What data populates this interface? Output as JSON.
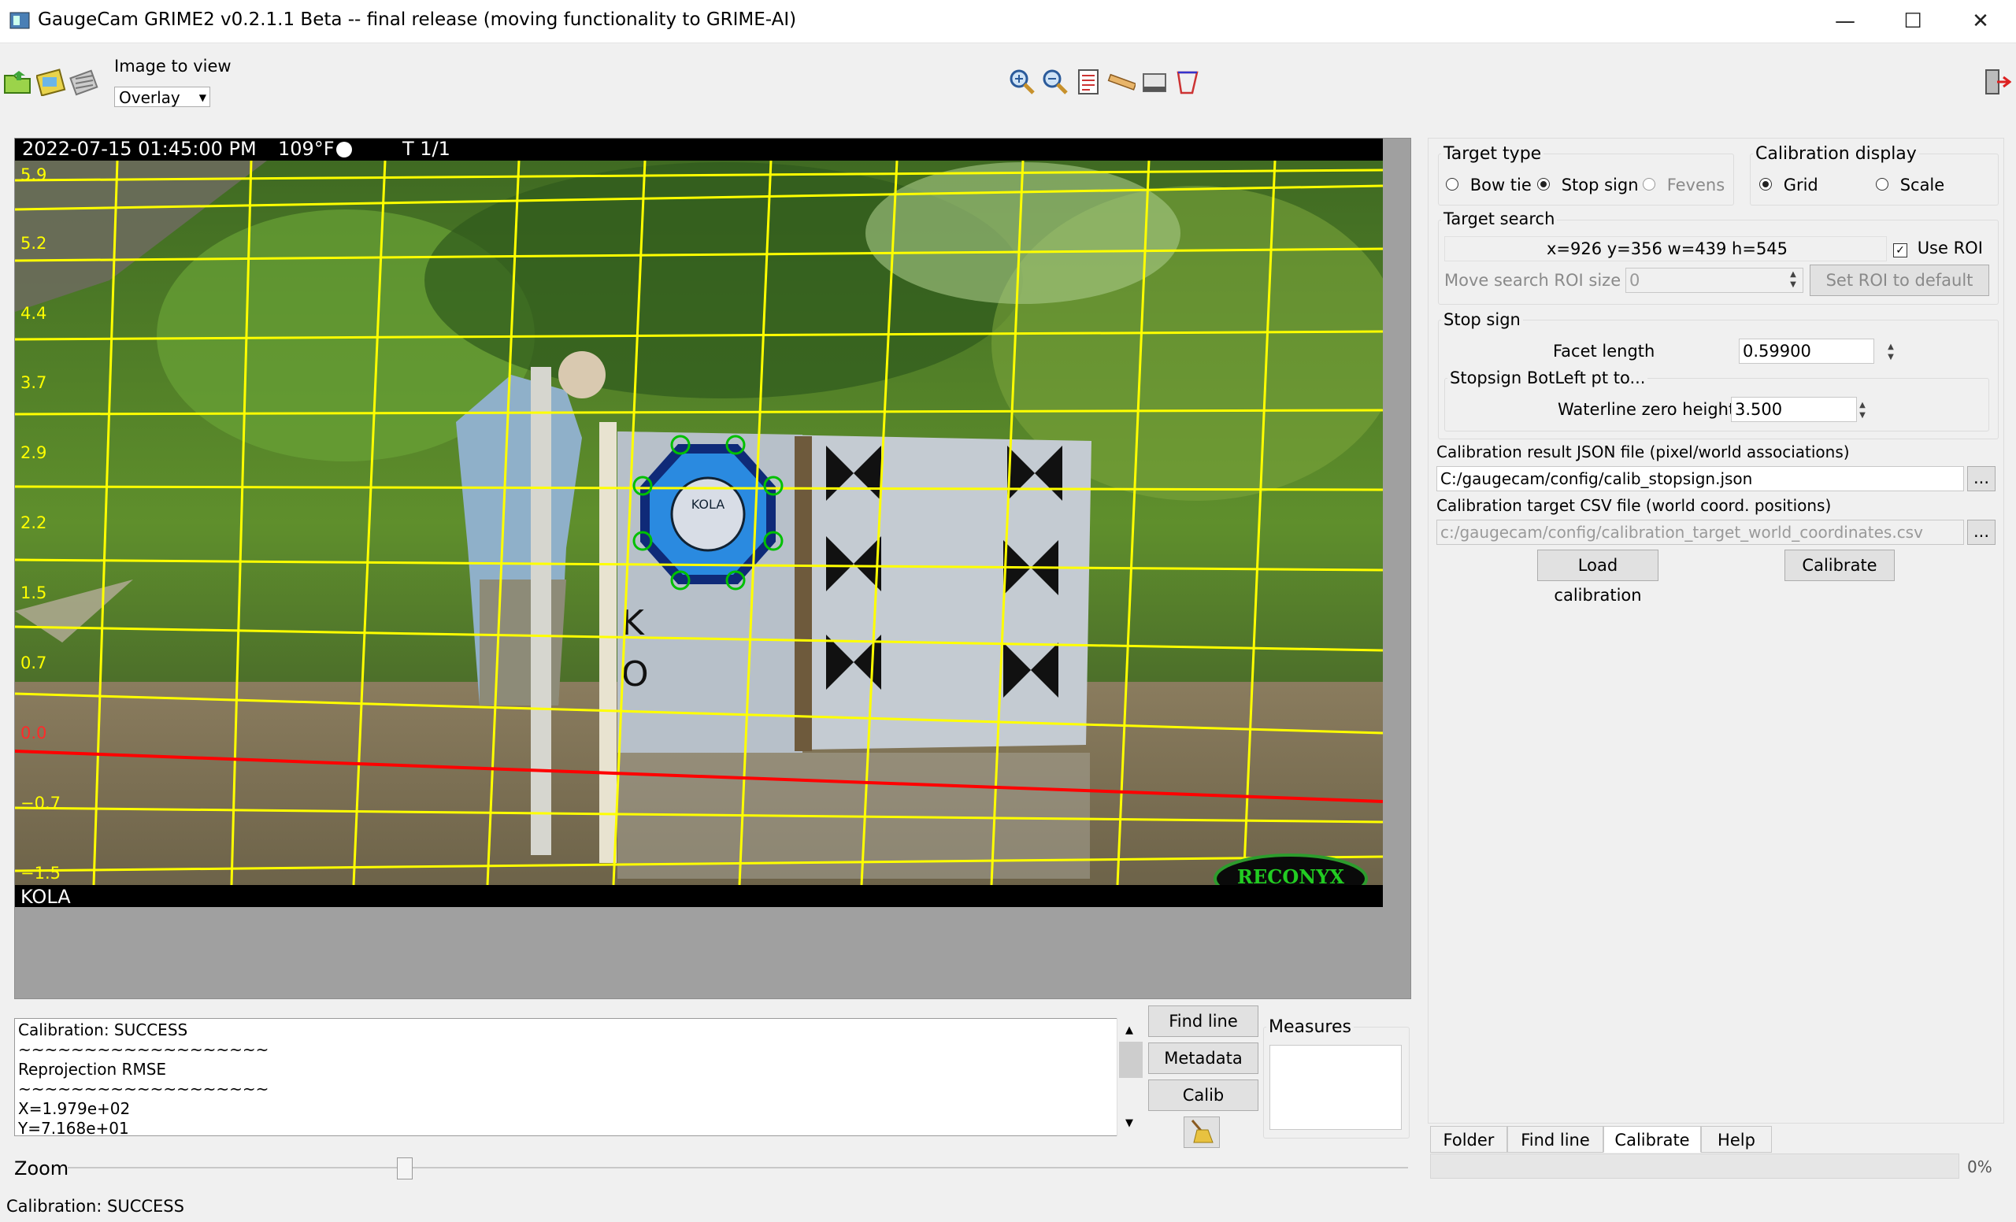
{
  "window": {
    "title": "GaugeCam GRIME2 v0.2.1.1 Beta -- final release (moving functionality to GRIME-AI)",
    "minimize": "—",
    "maximize": "☐",
    "close": "✕"
  },
  "toolbar": {
    "image_to_view_label": "Image to view",
    "image_to_view_value": "Overlay",
    "tools": [
      "zoom-in-icon",
      "zoom-out-icon",
      "list-icon",
      "ruler-icon",
      "rectangle-icon",
      "polygon-icon"
    ]
  },
  "image": {
    "timestamp": "2022-07-15 01:45:00 PM",
    "temperature": "109°F",
    "frame": "T 1/1",
    "camera_name": "KOLA",
    "logo_text": "RECONYX",
    "sign_text": "KOLA",
    "scale_labels": [
      "5.9",
      "5.2",
      "4.4",
      "3.7",
      "2.9",
      "2.2",
      "1.5",
      "0.7",
      "0.0",
      "−0.7",
      "−1.5"
    ],
    "grid_color": "#ffff00",
    "waterline_color": "#ff0000",
    "target_point_color": "#00c000"
  },
  "log": {
    "lines": [
      "Calibration: SUCCESS",
      "~~~~~~~~~~~~~~~~~~~",
      "Reprojection RMSE",
      "~~~~~~~~~~~~~~~~~~~",
      "X=1.979e+02",
      "Y=7.168e+01"
    ]
  },
  "actions": {
    "find_line": "Find line",
    "metadata": "Metadata",
    "calib": "Calib",
    "measures": "Measures"
  },
  "zoom": {
    "label": "Zoom"
  },
  "status": {
    "text": "Calibration: SUCCESS",
    "progress": "0%"
  },
  "target_type": {
    "title": "Target type",
    "options": [
      "Bow tie",
      "Stop sign",
      "Fevens"
    ],
    "selected": "Stop sign"
  },
  "calibration_display": {
    "title": "Calibration display",
    "options": [
      "Grid",
      "Scale"
    ],
    "selected": "Grid"
  },
  "target_search": {
    "title": "Target search",
    "roi_value": "x=926  y=356  w=439  h=545",
    "use_roi_label": "Use ROI",
    "use_roi_checked": true,
    "move_roi_label": "Move search ROI size",
    "move_roi_value": "0",
    "set_roi_default": "Set ROI to default"
  },
  "stop_sign": {
    "title": "Stop sign",
    "facet_length_label": "Facet length",
    "facet_length_value": "0.59900",
    "botleft_title": "Stopsign BotLeft pt to...",
    "waterline_label": "Waterline zero height",
    "waterline_value": "3.500"
  },
  "files": {
    "json_label": "Calibration result JSON file (pixel/world associations)",
    "json_value": "C:/gaugecam/config/calib_stopsign.json",
    "csv_label": "Calibration target CSV file (world coord. positions)",
    "csv_value": "c:/gaugecam/config/calibration_target_world_coordinates.csv",
    "browse": "...",
    "load_calibration": "Load calibration",
    "calibrate": "Calibrate"
  },
  "tabs": [
    "Folder",
    "Find line",
    "Calibrate",
    "Help"
  ],
  "active_tab": "Calibrate"
}
